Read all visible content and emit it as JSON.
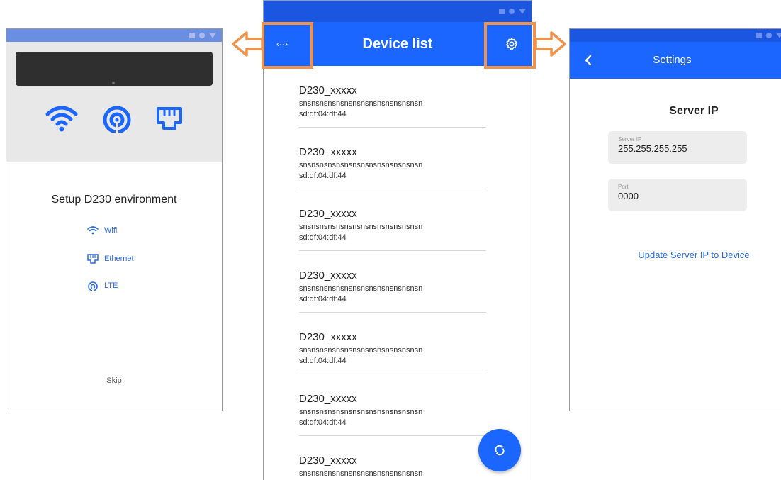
{
  "setup_screen": {
    "title": "Setup D230 environment",
    "options": [
      {
        "label": "Wifi",
        "icon": "wifi-icon"
      },
      {
        "label": "Ethernet",
        "icon": "ethernet-icon"
      },
      {
        "label": "LTE",
        "icon": "lte-icon"
      }
    ],
    "skip_label": "Skip"
  },
  "device_list_screen": {
    "title": "Device list",
    "left_icon_glyph": "‹··›",
    "left_icon": "code-arrows-icon",
    "right_icon": "gear-icon",
    "fab_icon": "refresh-icon",
    "items": [
      {
        "name": "D230_xxxxx",
        "serial": "snsnsnsnsnsnsnsnsnsnsnsnsnsnsn",
        "mac": "sd:df:04:df:44"
      },
      {
        "name": "D230_xxxxx",
        "serial": "snsnsnsnsnsnsnsnsnsnsnsnsnsnsn",
        "mac": "sd:df:04:df:44"
      },
      {
        "name": "D230_xxxxx",
        "serial": "snsnsnsnsnsnsnsnsnsnsnsnsnsnsn",
        "mac": "sd:df:04:df:44"
      },
      {
        "name": "D230_xxxxx",
        "serial": "snsnsnsnsnsnsnsnsnsnsnsnsnsnsn",
        "mac": "sd:df:04:df:44"
      },
      {
        "name": "D230_xxxxx",
        "serial": "snsnsnsnsnsnsnsnsnsnsnsnsnsnsn",
        "mac": "sd:df:04:df:44"
      },
      {
        "name": "D230_xxxxx",
        "serial": "snsnsnsnsnsnsnsnsnsnsnsnsnsnsn",
        "mac": "sd:df:04:df:44"
      },
      {
        "name": "D230_xxxxx",
        "serial": "snsnsnsnsnsnsnsnsnsnsnsnsnsnsn",
        "mac": ""
      }
    ]
  },
  "settings_screen": {
    "title": "Settings",
    "section_title": "Server IP",
    "server_ip": {
      "label": "Server IP",
      "value": "255.255.255.255"
    },
    "port": {
      "label": "Port",
      "value": "0000"
    },
    "update_link": "Update Server IP to Device"
  },
  "colors": {
    "primary": "#1a66ff",
    "status_bar": "#1a56e0",
    "highlight": "#f0924a",
    "link": "#2b6be8"
  }
}
